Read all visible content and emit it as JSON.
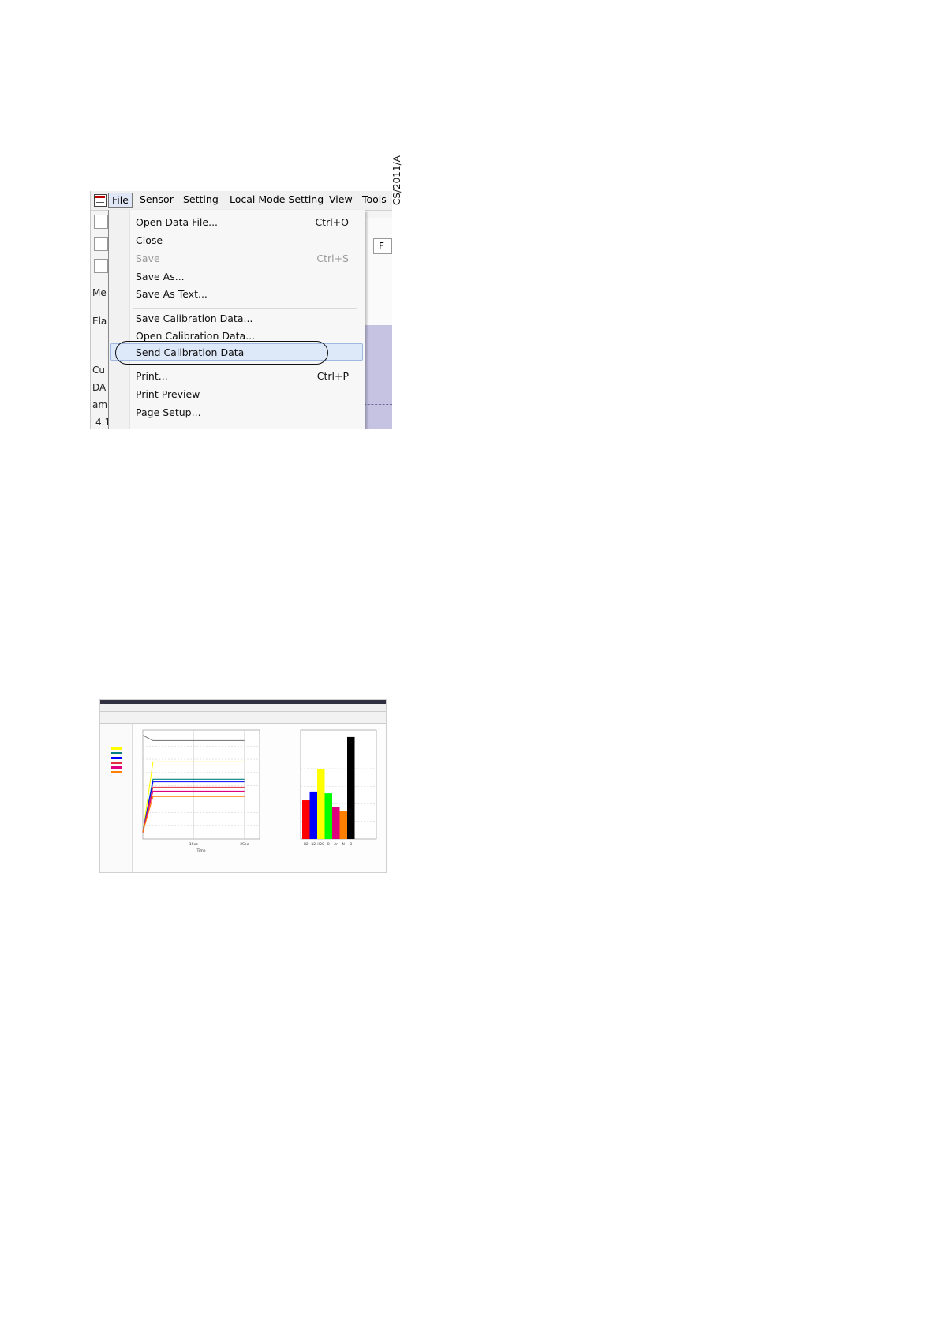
{
  "menubar": {
    "items": [
      "File",
      "Sensor",
      "Setting",
      "Local Mode Setting",
      "View",
      "Tools"
    ]
  },
  "file_menu": {
    "open_data_file": "Open Data File...",
    "open_data_file_shortcut": "Ctrl+O",
    "close": "Close",
    "save": "Save",
    "save_shortcut": "Ctrl+S",
    "save_as": "Save As...",
    "save_as_text": "Save As Text...",
    "save_calibration_data": "Save Calibration Data...",
    "open_calibration_data": "Open Calibration Data...",
    "send_calibration_data": "Send Calibration Data",
    "print": "Print...",
    "print_shortcut": "Ctrl+P",
    "print_preview": "Print Preview",
    "page_setup": "Page Setup..."
  },
  "background_fragments": [
    "Me",
    "Ela",
    "Cu",
    "DA",
    "am",
    "4.1",
    "F"
  ],
  "figure_caption": "CS/2011/A",
  "colors": {
    "highlight": "#dde8f8",
    "bar_colors": [
      "#ff0000",
      "#0000ff",
      "#ffff00",
      "#00ff00",
      "#e0007f",
      "#ff7f00",
      "#000000"
    ]
  },
  "data_window": {
    "x_tick_labels": [
      "1Sec",
      "2Sec"
    ],
    "x_label": "Time",
    "bar_axis_labels": [
      "H2",
      "N2",
      "H2O",
      "O",
      "Ar",
      "N",
      "O"
    ]
  },
  "chart_data": {
    "type": "line",
    "x": [
      0,
      0.2,
      1,
      2
    ],
    "series": [
      {
        "color": "#ffff00",
        "values": [
          0.5,
          5.8,
          5.8,
          5.8
        ]
      },
      {
        "color": "#008080",
        "values": [
          0.5,
          4.5,
          4.5,
          4.5
        ]
      },
      {
        "color": "#0000ff",
        "values": [
          0.5,
          4.3,
          4.3,
          4.3
        ]
      },
      {
        "color": "#e03040",
        "values": [
          0.5,
          3.9,
          3.9,
          3.9
        ]
      },
      {
        "color": "#e0007f",
        "values": [
          0.5,
          3.6,
          3.6,
          3.6
        ]
      },
      {
        "color": "#ff7f00",
        "values": [
          0.5,
          3.2,
          3.2,
          3.2
        ]
      },
      {
        "color": "#808080",
        "values": [
          7.8,
          7.4,
          7.4,
          7.4
        ]
      }
    ],
    "bars": {
      "categories": [
        "H2",
        "N2",
        "H2O",
        "O",
        "Ar",
        "N",
        "O"
      ],
      "values": [
        2.2,
        2.7,
        4.0,
        2.6,
        1.8,
        1.6,
        5.8
      ]
    }
  }
}
